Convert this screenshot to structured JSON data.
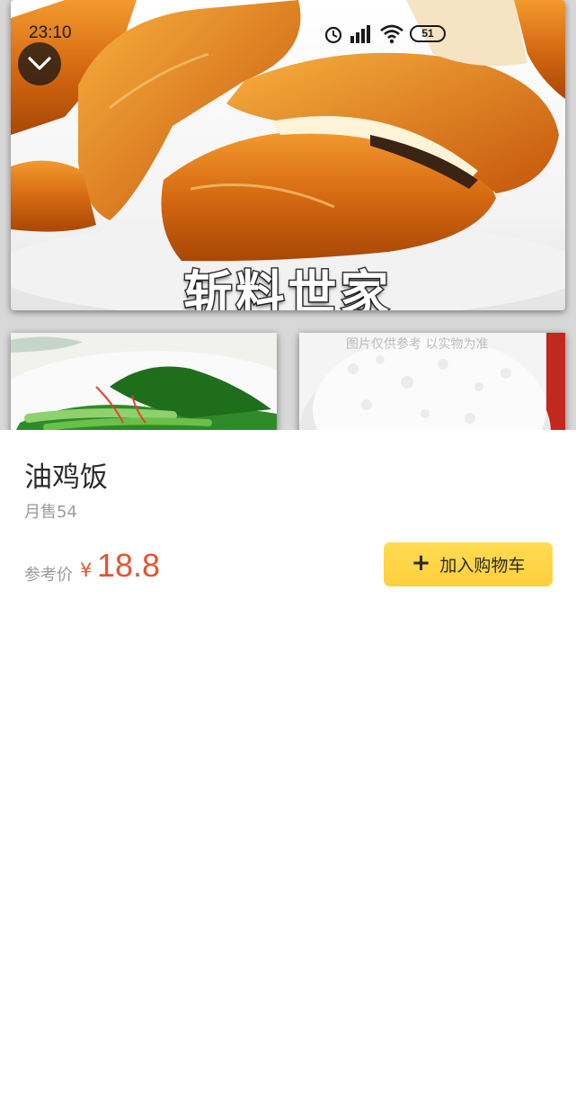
{
  "status_bar": {
    "time": "23:10",
    "battery": "51",
    "icons": [
      "alarm-icon",
      "signal-icon",
      "wifi-icon",
      "battery-icon"
    ]
  },
  "gallery": {
    "main_caption": "斩料世家",
    "watermark": "图片仅供参考  以实物为准"
  },
  "item": {
    "name": "油鸡饭",
    "monthly_sales": "月售54",
    "price_label": "参考价",
    "currency": "¥",
    "price": "18.8"
  },
  "actions": {
    "add_to_cart_label": "加入购物车"
  },
  "colors": {
    "accent_price": "#e0562f",
    "cart_button": "#ffd447"
  }
}
